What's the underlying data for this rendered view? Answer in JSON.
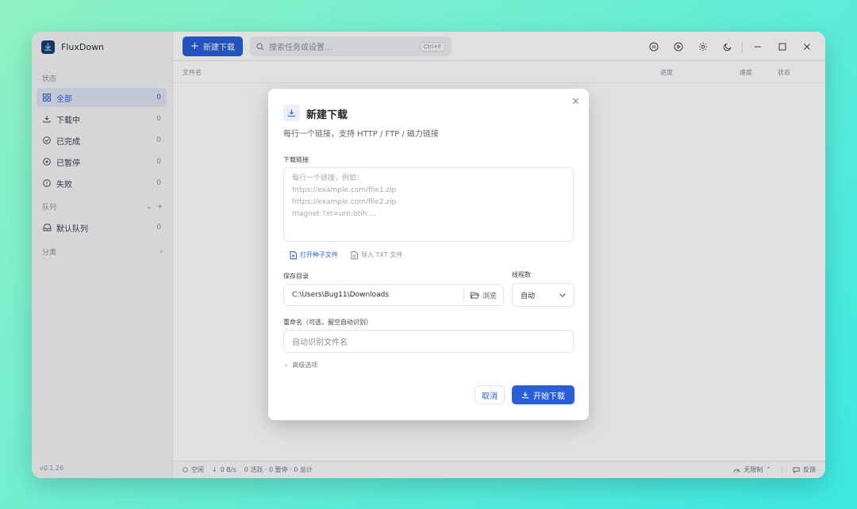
{
  "app": {
    "name": "FluxDown",
    "version": "v0.1.26"
  },
  "sidebar": {
    "status_label": "状态",
    "items": [
      {
        "label": "全部",
        "count": "0"
      },
      {
        "label": "下载中",
        "count": "0"
      },
      {
        "label": "已完成",
        "count": "0"
      },
      {
        "label": "已暂停",
        "count": "0"
      },
      {
        "label": "失败",
        "count": "0"
      }
    ],
    "queue_label": "队列",
    "queues": [
      {
        "label": "默认队列",
        "count": "0"
      }
    ],
    "category_label": "分类"
  },
  "toolbar": {
    "new_download_label": "新建下载",
    "search_placeholder": "搜索任务或设置...",
    "search_shortcut": "Ctrl+F"
  },
  "table": {
    "columns": [
      "文件名",
      "进度",
      "速度",
      "状态"
    ]
  },
  "statusbar": {
    "state": "空闲",
    "speed": "0 B/s",
    "summary": "0 活跃 · 0 暂停 · 0 总计",
    "limit": "无限制",
    "feedback": "反馈"
  },
  "dialog": {
    "title": "新建下载",
    "subtitle": "每行一个链接，支持 HTTP / FTP / 磁力链接",
    "url_label": "下载链接",
    "url_placeholder": "每行一个链接，例如：\nhttps://example.com/file1.zip\nhttps://example.com/file2.zip\nmagnet:?xt=urn:btih:...",
    "open_torrent_label": "打开种子文件",
    "import_txt_label": "导入 TXT 文件",
    "save_dir_label": "保存目录",
    "save_dir_value": "C:\\Users\\Bug11\\Downloads",
    "browse_label": "浏览",
    "threads_label": "线程数",
    "threads_value": "自动",
    "rename_label": "重命名（可选，留空自动识别）",
    "rename_placeholder": "自动识别文件名",
    "advanced_label": "高级选项",
    "cancel_label": "取消",
    "start_label": "开始下载"
  },
  "colors": {
    "accent": "#2a5fd9",
    "sidebar_bg": "#f3f4f6"
  }
}
